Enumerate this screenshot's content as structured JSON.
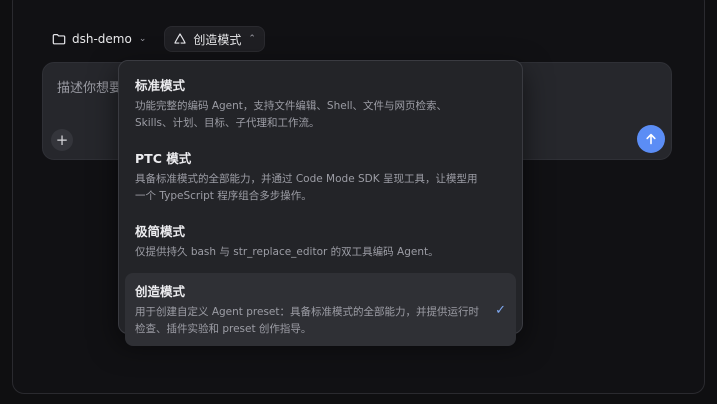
{
  "topbar": {
    "project_label": "dsh-demo",
    "mode_label": "创造模式",
    "chevron": "⌄"
  },
  "composer": {
    "placeholder": "描述你想要",
    "plus_label": "+"
  },
  "dropdown": {
    "options": [
      {
        "title": "标准模式",
        "desc": "功能完整的编码 Agent，支持文件编辑、Shell、文件与网页检索、Skills、计划、目标、子代理和工作流。"
      },
      {
        "title": "PTC 模式",
        "desc": "具备标准模式的全部能力，并通过 Code Mode SDK 呈现工具，让模型用一个 TypeScript 程序组合多步操作。"
      },
      {
        "title": "极简模式",
        "desc": "仅提供持久 bash 与 str_replace_editor 的双工具编码 Agent。"
      },
      {
        "title": "创造模式",
        "desc": "用于创建自定义 Agent preset：具备标准模式的全部能力，并提供运行时检查、插件实验和 preset 创作指导。",
        "check": "✓"
      }
    ]
  },
  "colors": {
    "accent": "#5b8df5",
    "check": "#7fa8f0"
  },
  "icons": {
    "folder": "folder-icon",
    "mode": "recycle-icon",
    "send": "arrow-up-icon"
  }
}
